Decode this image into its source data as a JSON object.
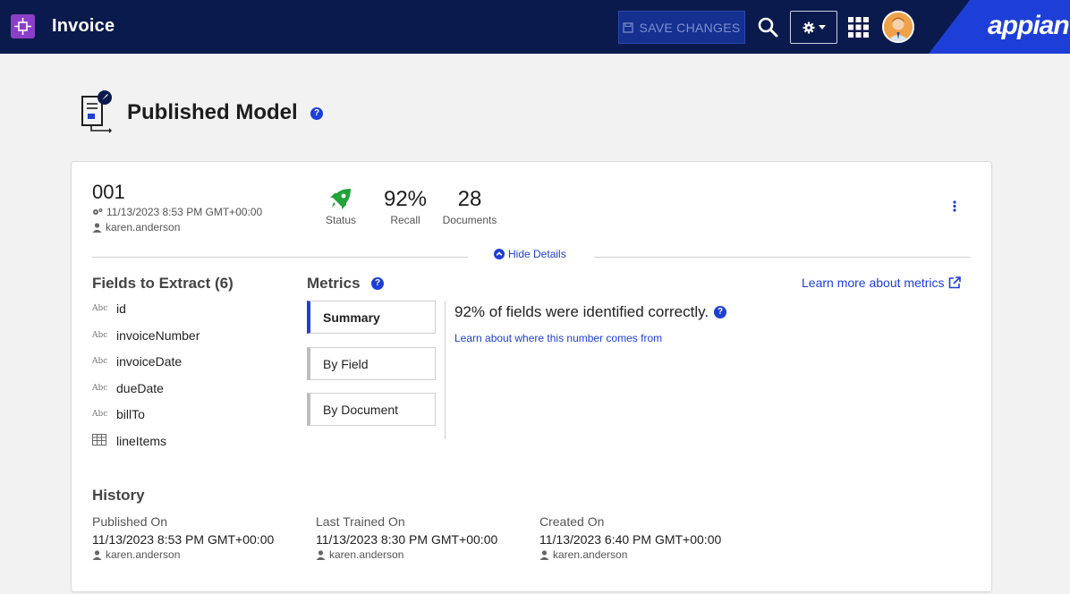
{
  "header": {
    "app_title": "Invoice",
    "save_label": "SAVE CHANGES",
    "brand": "appian",
    "colors": {
      "topbar": "#0b1a4d",
      "app_icon": "#8b3fc8",
      "brand_blue": "#1d3fd8"
    }
  },
  "page": {
    "title": "Published Model"
  },
  "model": {
    "id": "001",
    "date": "11/13/2023 8:53 PM GMT+00:00",
    "user": "karen.anderson",
    "stats": {
      "status_label": "Status",
      "recall_value": "92%",
      "recall_label": "Recall",
      "documents_value": "28",
      "documents_label": "Documents"
    },
    "hide_details": "Hide Details"
  },
  "fields": {
    "heading": "Fields to Extract (6)",
    "items": [
      {
        "icon": "text-field-icon",
        "name": "id"
      },
      {
        "icon": "text-field-icon",
        "name": "invoiceNumber"
      },
      {
        "icon": "text-field-icon",
        "name": "invoiceDate"
      },
      {
        "icon": "text-field-icon",
        "name": "dueDate"
      },
      {
        "icon": "text-field-icon",
        "name": "billTo"
      },
      {
        "icon": "table-icon",
        "name": "lineItems"
      }
    ],
    "abc": "Abc"
  },
  "metrics": {
    "heading": "Metrics",
    "learn_more": "Learn more about metrics",
    "tabs": [
      "Summary",
      "By Field",
      "By Document"
    ],
    "active_tab": "Summary",
    "summary_text": "92% of fields were identified correctly.",
    "learn_where": "Learn about where this number comes from"
  },
  "history": {
    "heading": "History",
    "entries": [
      {
        "label": "Published On",
        "date": "11/13/2023 8:53 PM GMT+00:00",
        "user": "karen.anderson"
      },
      {
        "label": "Last Trained On",
        "date": "11/13/2023 8:30 PM GMT+00:00",
        "user": "karen.anderson"
      },
      {
        "label": "Created On",
        "date": "11/13/2023 6:40 PM GMT+00:00",
        "user": "karen.anderson"
      }
    ]
  }
}
